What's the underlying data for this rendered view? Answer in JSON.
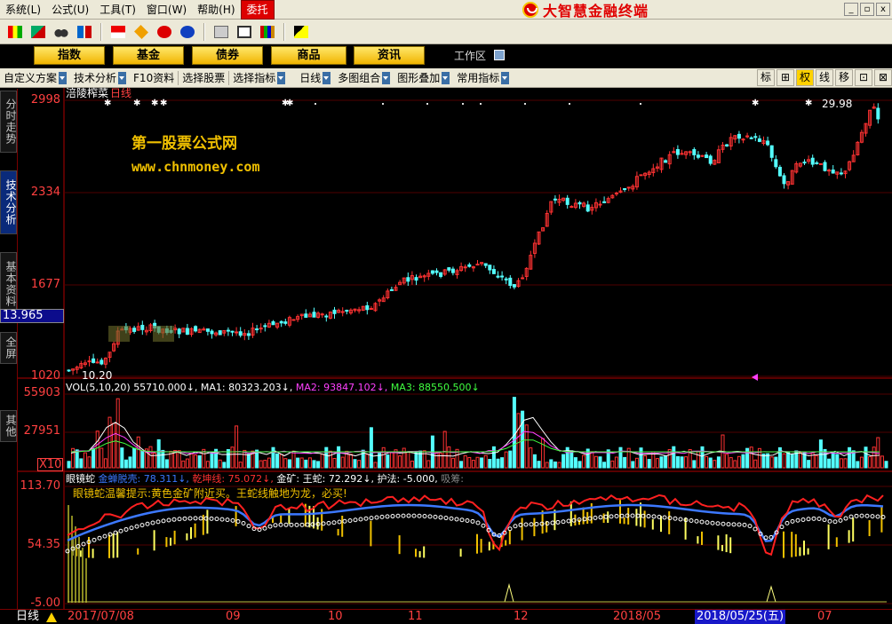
{
  "menu": {
    "items": [
      "系统(L)",
      "公式(U)",
      "工具(T)",
      "窗口(W)",
      "帮助(H)"
    ],
    "active": "委托",
    "brand": "大智慧金融终端"
  },
  "toolbar": {
    "icons": [
      "flag-icon",
      "arrows-icon",
      "binoculars-icon",
      "up-down-icon",
      "flag-red-icon",
      "diamond-icon",
      "red-ball-icon",
      "blue-ball-icon",
      "screen-icon",
      "layout-icon",
      "books-icon",
      "help-pointer-icon"
    ]
  },
  "tabs": [
    "指数",
    "基金",
    "债券",
    "商品",
    "资讯"
  ],
  "workspace": "工作区",
  "funcbar": {
    "items": [
      "自定义方案",
      "技术分析",
      "F10资料",
      "选择股票",
      "选择指标",
      "日线",
      "多图组合",
      "图形叠加",
      "常用指标"
    ],
    "right_buttons": [
      "标",
      "⊞",
      "权",
      "线",
      "移",
      "⊡",
      "⊠"
    ]
  },
  "sidetabs": [
    "分时走势",
    "技术分析",
    "基本资料",
    "全屏",
    "其他"
  ],
  "stock": {
    "name": "涪陵榨菜",
    "period": "日线",
    "brand_text_1": "第一股票公式网",
    "brand_text_2": "www.chnmoney.com",
    "price_cursor": "13.965",
    "high_mark": "29.98",
    "low_mark": "10.20"
  },
  "price_axis": [
    "2998",
    "2334",
    "1677",
    "1020"
  ],
  "vol": {
    "header_name": "VOL(5,10,20)",
    "header_value": "55710.000",
    "ma1_label": "MA1:",
    "ma1_value": "80323.203",
    "ma2_label": "MA2:",
    "ma2_value": "93847.102",
    "ma3_label": "MA3:",
    "ma3_value": "88550.500",
    "axis": [
      "55903",
      "27951"
    ],
    "unit": "X10"
  },
  "ind": {
    "name": "眼镜蛇",
    "l1_label": "金蝉脱壳:",
    "l1_value": "78.311",
    "l2_label": "乾坤线:",
    "l2_value": "75.072",
    "l3_label": "金矿:",
    "l4_label": "王蛇:",
    "l4_value": "72.292",
    "l5_label": "护法:",
    "l5_value": "-5.000",
    "l6_label": "吸筹:",
    "tip": "眼镜蛇温馨提示:黄色金矿附近买。王蛇线触地为龙，必买!",
    "axis": [
      "113.70",
      "54.35",
      "-5.00"
    ]
  },
  "dates": {
    "period_label": "日线",
    "labels": [
      "2017/07/08",
      "09",
      "10",
      "11",
      "12",
      "2018/05",
      "07"
    ],
    "selected": "2018/05/25(五)"
  },
  "colors": {
    "up": "#ff3232",
    "down": "#54ffff",
    "ma1": "#ffffff",
    "ma2": "#ff40ff",
    "ma3": "#40ff40",
    "blue_line": "#3c78ff",
    "red_line": "#ff2020",
    "gold": "#f0c000"
  }
}
